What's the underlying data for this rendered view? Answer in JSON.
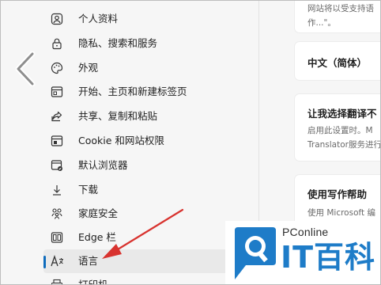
{
  "sidebar": {
    "items": [
      {
        "label": "个人资料",
        "icon": "profile-icon"
      },
      {
        "label": "隐私、搜索和服务",
        "icon": "lock-icon"
      },
      {
        "label": "外观",
        "icon": "appearance-icon"
      },
      {
        "label": "开始、主页和新建标签页",
        "icon": "home-page-icon"
      },
      {
        "label": "共享、复制和粘贴",
        "icon": "share-icon"
      },
      {
        "label": "Cookie 和网站权限",
        "icon": "site-permissions-icon"
      },
      {
        "label": "默认浏览器",
        "icon": "default-browser-icon"
      },
      {
        "label": "下载",
        "icon": "download-icon"
      },
      {
        "label": "家庭安全",
        "icon": "family-icon"
      },
      {
        "label": "Edge 栏",
        "icon": "edge-bar-icon"
      },
      {
        "label": "语言",
        "icon": "language-icon",
        "active": true
      },
      {
        "label": "打印机",
        "icon": "printer-icon"
      }
    ]
  },
  "panel": {
    "card1": {
      "line1": "网站将以受支持语",
      "line2": "作...\"。"
    },
    "card2": {
      "title": "中文（简体）"
    },
    "card3": {
      "title": "让我选择翻译不",
      "line1": "启用此设置时。M",
      "line2": "Translator服务进行"
    },
    "card4": {
      "title": "使用写作帮助",
      "line1": "使用 Microsoft 编"
    }
  },
  "watermark": {
    "brand": "PConline",
    "name": "IT百科"
  },
  "colors": {
    "accent": "#0f6cbd",
    "arrow": "#d8332f",
    "logo_blue": "#1e7cc8"
  }
}
